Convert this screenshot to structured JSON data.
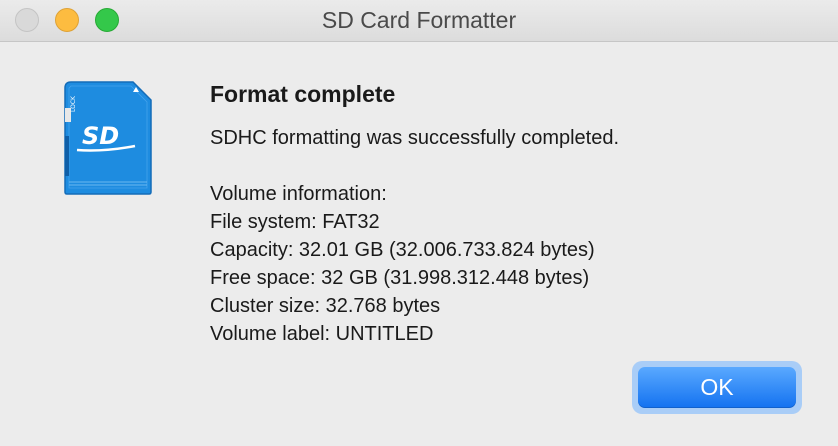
{
  "window": {
    "title": "SD Card Formatter"
  },
  "icon": {
    "name": "sd-card-icon",
    "logo_text": "SD",
    "lock_text": "LOCK",
    "color": "#1e8ce0"
  },
  "dialog": {
    "heading": "Format complete",
    "message": "SDHC formatting was successfully completed.",
    "volume_info": [
      "Volume information:",
      "File system: FAT32",
      "Capacity: 32.01 GB (32.006.733.824 bytes)",
      "Free space: 32 GB (31.998.312.448 bytes)",
      "Cluster size: 32.768 bytes",
      "Volume label: UNTITLED"
    ],
    "ok_label": "OK"
  },
  "colors": {
    "close": "#d9d9d9",
    "minimize": "#fdbc40",
    "zoom": "#34c84a",
    "accent": "#1372f0"
  }
}
